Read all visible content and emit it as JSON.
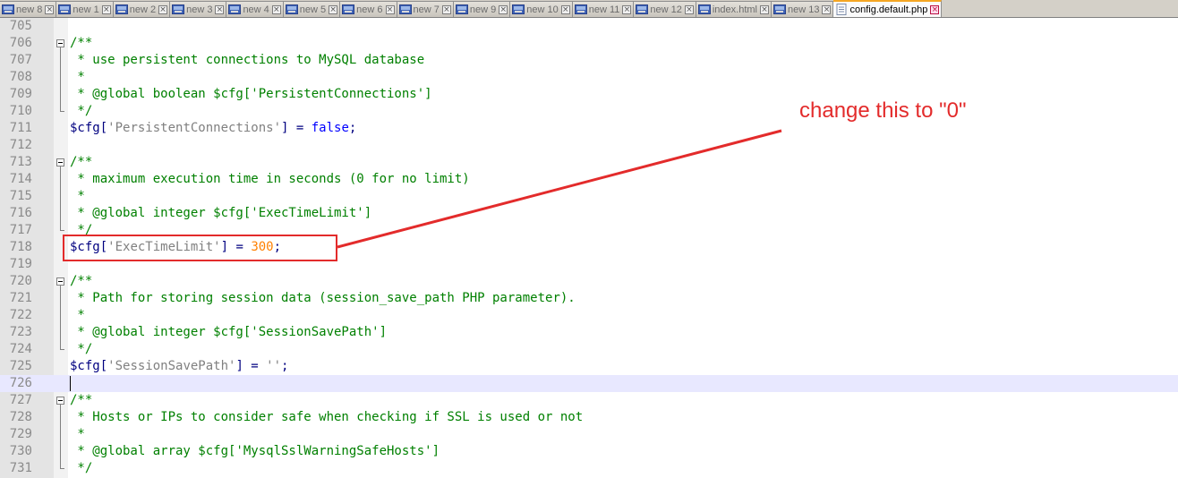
{
  "tabs": [
    {
      "label": "new 8",
      "active": false
    },
    {
      "label": "new 1",
      "active": false
    },
    {
      "label": "new 2",
      "active": false
    },
    {
      "label": "new 3",
      "active": false
    },
    {
      "label": "new 4",
      "active": false
    },
    {
      "label": "new 5",
      "active": false
    },
    {
      "label": "new 6",
      "active": false
    },
    {
      "label": "new 7",
      "active": false
    },
    {
      "label": "new 9",
      "active": false
    },
    {
      "label": "new 10",
      "active": false
    },
    {
      "label": "new 11",
      "active": false
    },
    {
      "label": "new 12",
      "active": false
    },
    {
      "label": "index.html",
      "active": false
    },
    {
      "label": "new 13",
      "active": false
    },
    {
      "label": "config.default.php",
      "active": true
    }
  ],
  "tab_close_glyph": "×",
  "editor": {
    "current_line": "726",
    "lines": [
      {
        "n": "705",
        "t": []
      },
      {
        "n": "706",
        "t": [
          [
            "cmt",
            "/**"
          ]
        ]
      },
      {
        "n": "707",
        "t": [
          [
            "cmt",
            " * use persistent connections to MySQL database"
          ]
        ]
      },
      {
        "n": "708",
        "t": [
          [
            "cmt",
            " *"
          ]
        ]
      },
      {
        "n": "709",
        "t": [
          [
            "cmt",
            " * @global boolean $cfg['PersistentConnections']"
          ]
        ]
      },
      {
        "n": "710",
        "t": [
          [
            "cmt",
            " */"
          ]
        ]
      },
      {
        "n": "711",
        "t": [
          [
            "var",
            "$cfg"
          ],
          [
            "op",
            "["
          ],
          [
            "str",
            "'PersistentConnections'"
          ],
          [
            "op",
            "] = "
          ],
          [
            "kw",
            "false"
          ],
          [
            "op",
            ";"
          ]
        ]
      },
      {
        "n": "712",
        "t": []
      },
      {
        "n": "713",
        "t": [
          [
            "cmt",
            "/**"
          ]
        ]
      },
      {
        "n": "714",
        "t": [
          [
            "cmt",
            " * maximum execution time in seconds (0 for no limit)"
          ]
        ]
      },
      {
        "n": "715",
        "t": [
          [
            "cmt",
            " *"
          ]
        ]
      },
      {
        "n": "716",
        "t": [
          [
            "cmt",
            " * @global integer $cfg['ExecTimeLimit']"
          ]
        ]
      },
      {
        "n": "717",
        "t": [
          [
            "cmt",
            " */"
          ]
        ]
      },
      {
        "n": "718",
        "t": [
          [
            "var",
            "$cfg"
          ],
          [
            "op",
            "["
          ],
          [
            "str",
            "'ExecTimeLimit'"
          ],
          [
            "op",
            "] = "
          ],
          [
            "num",
            "300"
          ],
          [
            "op",
            ";"
          ]
        ]
      },
      {
        "n": "719",
        "t": []
      },
      {
        "n": "720",
        "t": [
          [
            "cmt",
            "/**"
          ]
        ]
      },
      {
        "n": "721",
        "t": [
          [
            "cmt",
            " * Path for storing session data (session_save_path PHP parameter)."
          ]
        ]
      },
      {
        "n": "722",
        "t": [
          [
            "cmt",
            " *"
          ]
        ]
      },
      {
        "n": "723",
        "t": [
          [
            "cmt",
            " * @global integer $cfg['SessionSavePath']"
          ]
        ]
      },
      {
        "n": "724",
        "t": [
          [
            "cmt",
            " */"
          ]
        ]
      },
      {
        "n": "725",
        "t": [
          [
            "var",
            "$cfg"
          ],
          [
            "op",
            "["
          ],
          [
            "str",
            "'SessionSavePath'"
          ],
          [
            "op",
            "] = "
          ],
          [
            "str",
            "''"
          ],
          [
            "op",
            ";"
          ]
        ]
      },
      {
        "n": "726",
        "t": []
      },
      {
        "n": "727",
        "t": [
          [
            "cmt",
            "/**"
          ]
        ]
      },
      {
        "n": "728",
        "t": [
          [
            "cmt",
            " * Hosts or IPs to consider safe when checking if SSL is used or not"
          ]
        ]
      },
      {
        "n": "729",
        "t": [
          [
            "cmt",
            " *"
          ]
        ]
      },
      {
        "n": "730",
        "t": [
          [
            "cmt",
            " * @global array $cfg['MysqlSslWarningSafeHosts']"
          ]
        ]
      },
      {
        "n": "731",
        "t": [
          [
            "cmt",
            " */"
          ]
        ]
      }
    ],
    "fold_blocks": [
      [
        "706",
        "710"
      ],
      [
        "713",
        "717"
      ],
      [
        "720",
        "724"
      ],
      [
        "727",
        "731"
      ]
    ]
  },
  "annotation": {
    "text": "change this to \"0\"",
    "highlighted_line": "718",
    "color": "#e32b2b"
  }
}
